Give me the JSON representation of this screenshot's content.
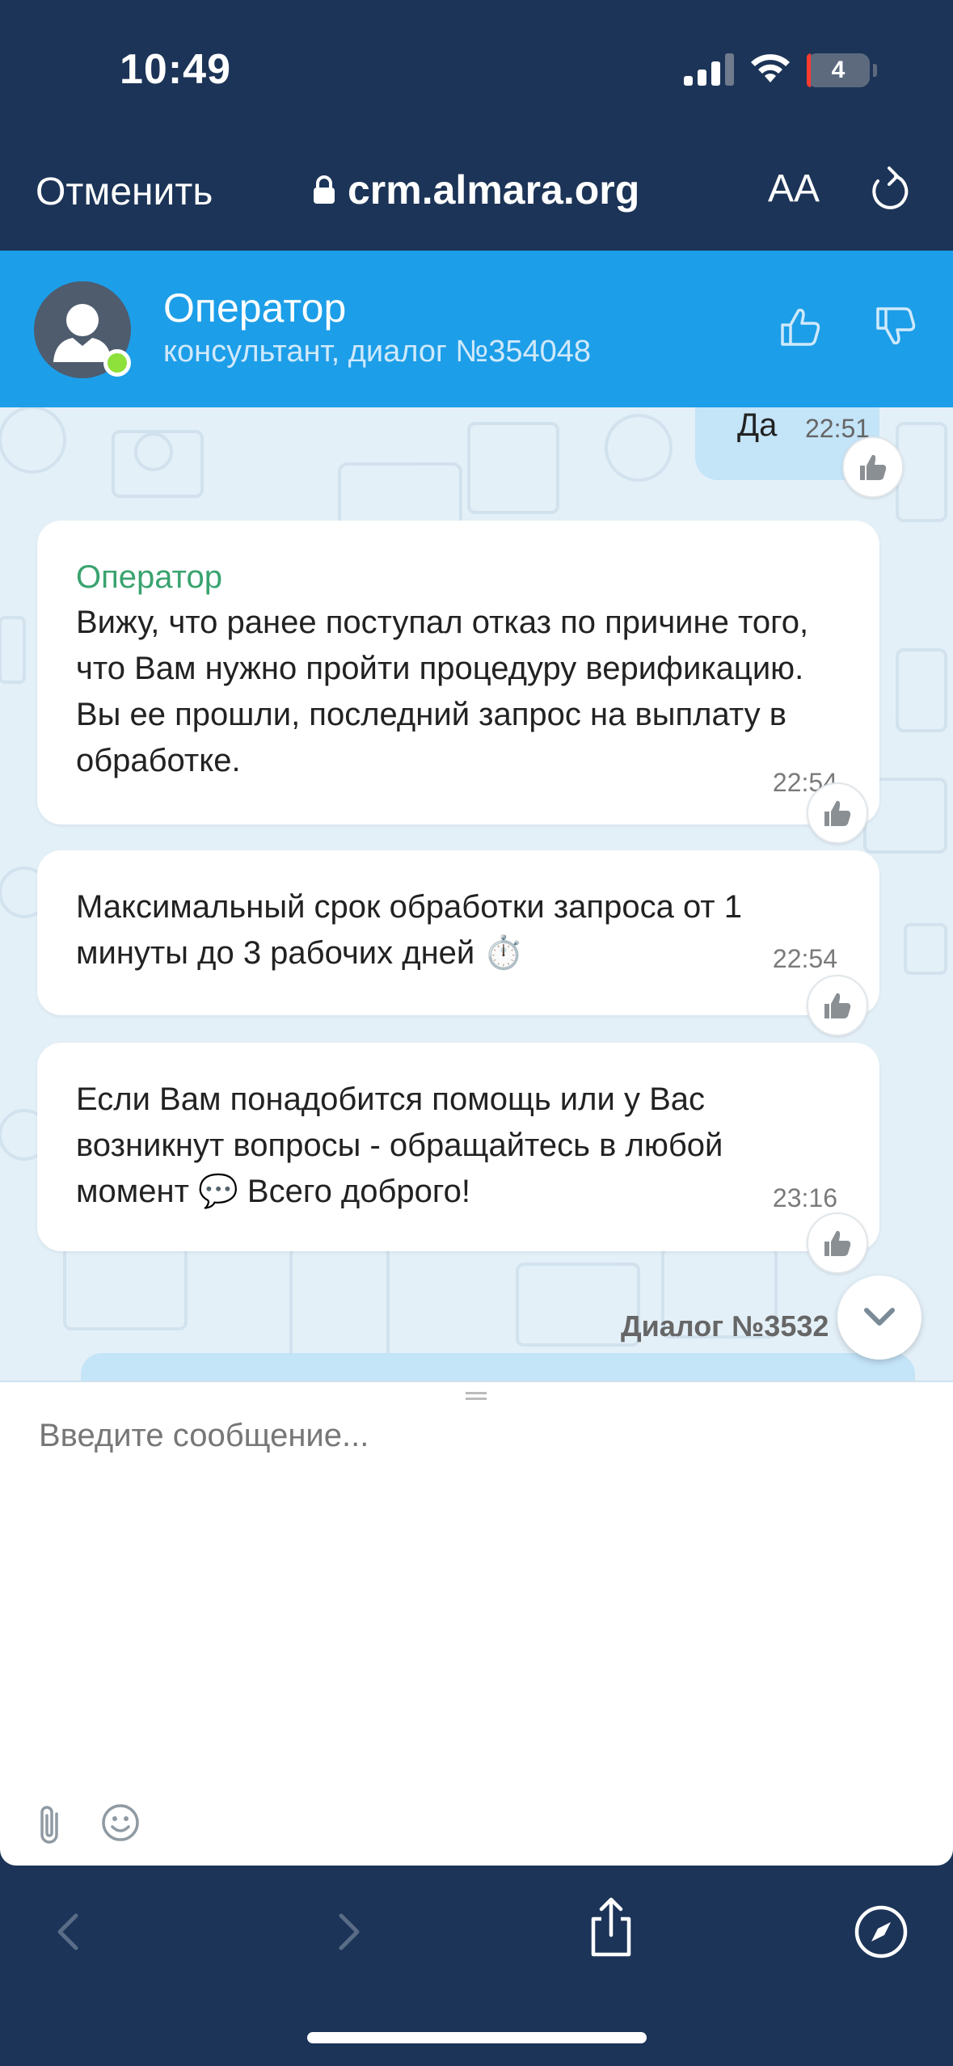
{
  "status_bar": {
    "time": "10:49",
    "battery": "4"
  },
  "browser": {
    "cancel_label": "Отменить",
    "url": "crm.almara.org",
    "text_size_label": "AA"
  },
  "chat_header": {
    "name": "Оператор",
    "subtitle": "консультант, диалог №354048"
  },
  "messages": {
    "outgoing": {
      "text": "Да",
      "time": "22:51"
    },
    "items": [
      {
        "author": "Оператор",
        "text": "Вижу, что ранее поступал отказ по причине того, что Вам нужно пройти процедуру верификацию. Вы ее прошли, последний запрос на выплату в обработке.",
        "time": "22:54"
      },
      {
        "text": "Максимальный срок обработки запроса от 1 минуты до 3 рабочих дней ⏱️",
        "time": "22:54"
      },
      {
        "text": "Если Вам понадобится помощь или у Вас возникнут вопросы - обращайтесь в любой момент 💬 Всего доброго!",
        "time": "23:16"
      }
    ],
    "dialog_label": "Диалог №3532"
  },
  "composer": {
    "placeholder": "Введите сообщение..."
  },
  "icons": [
    "signal-icon",
    "wifi-icon",
    "lock-icon",
    "reload-icon",
    "thumb-up-icon",
    "thumb-down-icon",
    "like-icon",
    "chevron-down-icon",
    "paperclip-icon",
    "smile-icon",
    "back-icon",
    "forward-icon",
    "share-icon",
    "compass-icon"
  ],
  "colors": {
    "header_blue": "#1d9ee8",
    "dark_navy": "#1c3457",
    "author_green": "#3aa36f",
    "outgoing_bubble": "#c4e4f8"
  }
}
